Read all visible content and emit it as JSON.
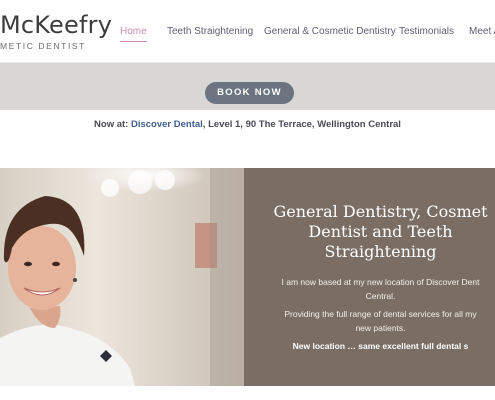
{
  "logo": {
    "name": "McKeefry",
    "subtitle": "METIC DENTIST"
  },
  "nav": {
    "items": [
      {
        "label": "Home",
        "active": true
      },
      {
        "label": "Teeth Straightening"
      },
      {
        "label": "General & Cosmetic Dentistry"
      },
      {
        "label": "Testimonials"
      },
      {
        "label": "Meet A"
      }
    ]
  },
  "booking": {
    "button_label": "BOOK NOW"
  },
  "address": {
    "prefix": "Now at: ",
    "link": "Discover Dental",
    "rest": ", Level 1, 90 The Terrace, Wellington Central"
  },
  "hero": {
    "title_lines": [
      "General Dentistry, Cosmet",
      "Dentist and Teeth",
      "Straightening"
    ],
    "para1_lines": [
      "I am now based at my new location of Discover Dent",
      "Central."
    ],
    "para2_lines": [
      "Providing the full range of dental services for all my",
      "new patients."
    ],
    "bold_line": "New location … same excellent full dental s"
  },
  "colors": {
    "accent_pink": "#c98bb6",
    "button_grey": "#6b7480",
    "panel_brown": "#7a6e64",
    "band_grey": "#d9d7d5"
  }
}
